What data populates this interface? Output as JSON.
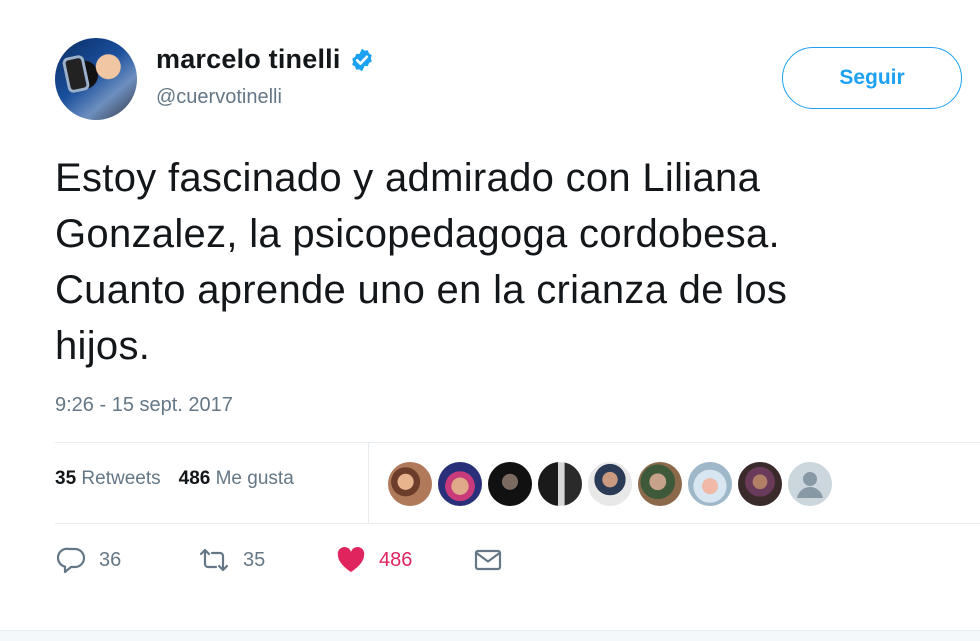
{
  "author": {
    "display_name": "marcelo tinelli",
    "handle": "@cuervotinelli",
    "verified_icon": "verified-badge-icon",
    "follow_label": "Seguir"
  },
  "tweet": {
    "lines": [
      "Estoy fascinado y admirado con Liliana",
      "Gonzalez, la psicopedagoga cordobesa.",
      "Cuanto aprende uno en la crianza de los",
      "hijos."
    ],
    "timestamp": "9:26 - 15 sept. 2017"
  },
  "stats": {
    "retweets_count": "35",
    "retweets_label": "Retweets",
    "likes_count": "486",
    "likes_label": "Me gusta"
  },
  "likers_count_shown": 9,
  "actions": {
    "reply_count": "36",
    "retweet_count": "35",
    "like_count": "486"
  },
  "colors": {
    "accent": "#1da1f2",
    "like": "#e0245e",
    "muted": "#657786"
  }
}
